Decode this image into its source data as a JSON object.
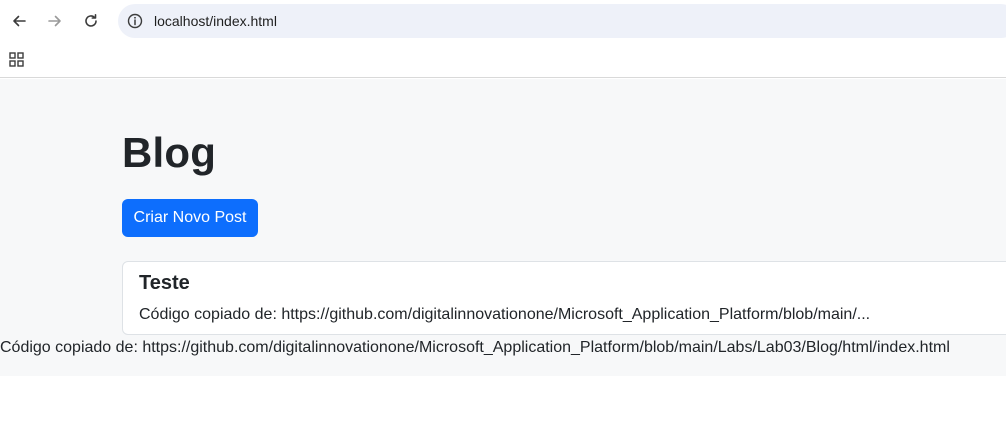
{
  "browser": {
    "url": "localhost/index.html"
  },
  "page": {
    "title": "Blog",
    "new_post_label": "Criar Novo Post",
    "posts": [
      {
        "title": "Teste",
        "excerpt": "Código copiado de: https://github.com/digitalinnovationone/Microsoft_Application_Platform/blob/main/..."
      }
    ],
    "footer": "Código copiado de: https://github.com/digitalinnovationone/Microsoft_Application_Platform/blob/main/Labs/Lab03/Blog/html/index.html"
  },
  "colors": {
    "primary": "#0d6efd",
    "page_background": "#f7f8f9",
    "text": "#212529",
    "omnibox": "#eef1f9"
  }
}
